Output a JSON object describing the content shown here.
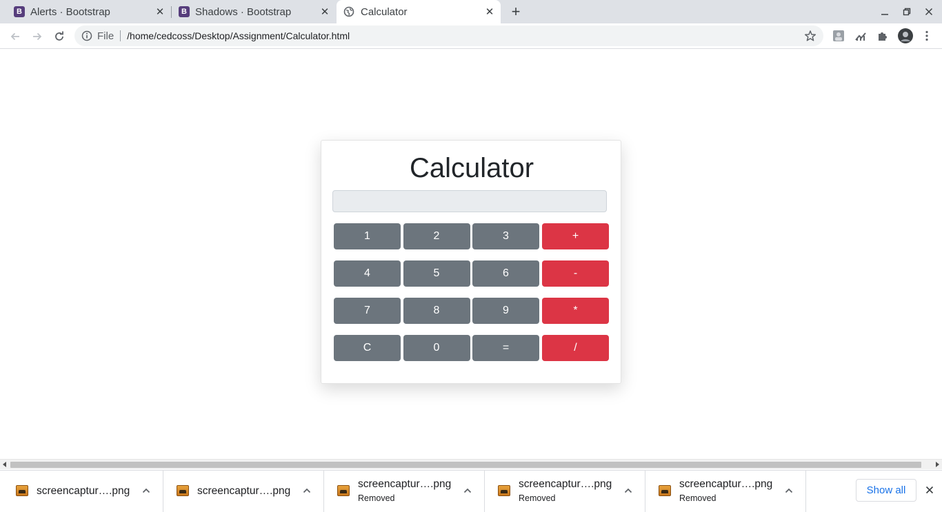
{
  "browser": {
    "tabs": [
      {
        "title": "Alerts · Bootstrap",
        "favicon": "B"
      },
      {
        "title": "Shadows · Bootstrap",
        "favicon": "B"
      },
      {
        "title": "Calculator",
        "favicon": "globe-icon"
      }
    ],
    "active_tab": "Calculator",
    "close_glyph": "✕",
    "new_tab_glyph": "+",
    "address": {
      "scheme_label": "File",
      "url": "/home/cedcoss/Desktop/Assignment/Calculator.html"
    }
  },
  "page": {
    "title": "Calculator",
    "display_value": "",
    "keys": [
      {
        "label": "1",
        "kind": "digit"
      },
      {
        "label": "2",
        "kind": "digit"
      },
      {
        "label": "3",
        "kind": "digit"
      },
      {
        "label": "+",
        "kind": "operator"
      },
      {
        "label": "4",
        "kind": "digit"
      },
      {
        "label": "5",
        "kind": "digit"
      },
      {
        "label": "6",
        "kind": "digit"
      },
      {
        "label": "-",
        "kind": "operator"
      },
      {
        "label": "7",
        "kind": "digit"
      },
      {
        "label": "8",
        "kind": "digit"
      },
      {
        "label": "9",
        "kind": "digit"
      },
      {
        "label": "*",
        "kind": "operator"
      },
      {
        "label": "C",
        "kind": "digit"
      },
      {
        "label": "0",
        "kind": "digit"
      },
      {
        "label": "=",
        "kind": "digit"
      },
      {
        "label": "/",
        "kind": "operator"
      }
    ],
    "colors": {
      "digit": "#6c757d",
      "operator": "#dc3545"
    }
  },
  "downloads": {
    "items": [
      {
        "name": "screencaptur….png",
        "status": ""
      },
      {
        "name": "screencaptur….png",
        "status": ""
      },
      {
        "name": "screencaptur….png",
        "status": "Removed"
      },
      {
        "name": "screencaptur….png",
        "status": "Removed"
      },
      {
        "name": "screencaptur….png",
        "status": "Removed"
      }
    ],
    "show_all_label": "Show all"
  }
}
